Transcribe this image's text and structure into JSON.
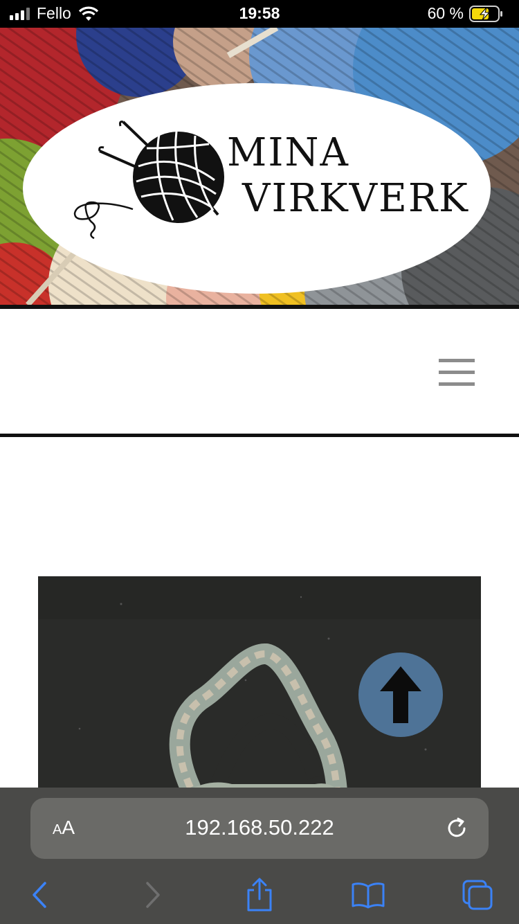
{
  "status_bar": {
    "carrier": "Fello",
    "time": "19:58",
    "battery_percent": "60 %"
  },
  "site": {
    "logo_line1": "MINA",
    "logo_line2": "VIRKVERK"
  },
  "browser": {
    "text_size_label_small": "A",
    "text_size_label_large": "A",
    "url": "192.168.50.222"
  },
  "colors": {
    "scroll_top_bg": "#4e7397",
    "toolbar_active": "#3b82f6",
    "toolbar_disabled": "#6f6f6f"
  },
  "icons": {
    "hamburger": "menu-icon",
    "scroll_top": "arrow-up-icon",
    "back": "chevron-left-icon",
    "forward": "chevron-right-icon",
    "share": "share-icon",
    "bookmarks": "book-icon",
    "tabs": "tabs-icon",
    "reload": "reload-icon"
  }
}
